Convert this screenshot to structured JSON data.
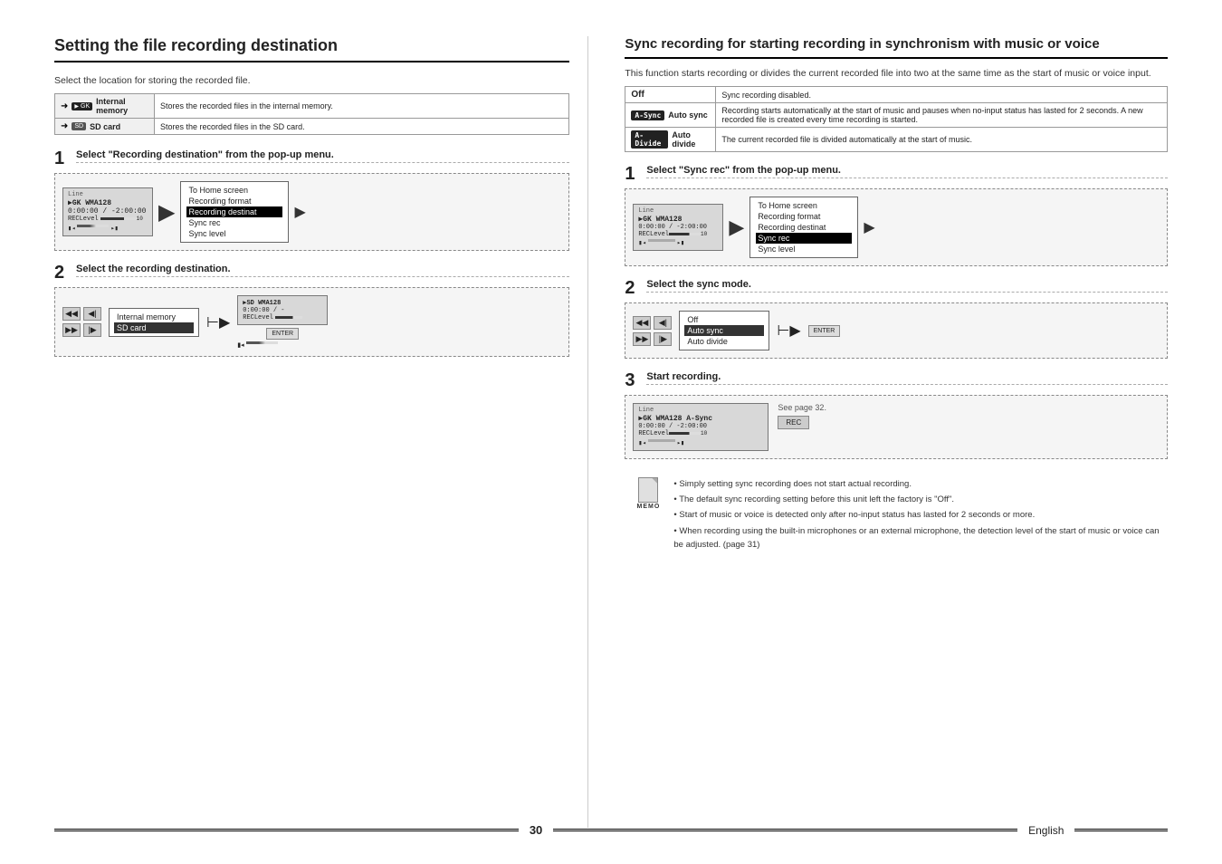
{
  "page": {
    "number": "30",
    "language": "English"
  },
  "left_section": {
    "title": "Setting the file recording destination",
    "intro": "Select the location for storing the recorded file.",
    "destination_table": {
      "rows": [
        {
          "icon_label": "INT",
          "badge": "internal",
          "name": "Internal memory",
          "description": "Stores the recorded files in the internal memory."
        },
        {
          "icon_label": "SD",
          "badge": "sd",
          "name": "SD card",
          "description": "Stores the recorded files in the SD card."
        }
      ]
    },
    "steps": [
      {
        "num": "1",
        "title": "Select \"Recording destination\" from the pop-up menu.",
        "screen": {
          "line": "Line",
          "mode": "▶GK WMA128",
          "time": "0:00:00 / -2:00:00",
          "level": "RECLevel",
          "bars": 10
        },
        "menu": {
          "items": [
            "To Home screen",
            "Recording format",
            "Recording destinat",
            "Sync rec",
            "Sync level"
          ],
          "highlighted": "Recording destinat"
        }
      },
      {
        "num": "2",
        "title": "Select the recording destination.",
        "options": [
          "Internal memory",
          "SD card"
        ],
        "highlighted": "SD card",
        "screen": {
          "mode": "▶SD WMA128",
          "time": "0:00:00 / -",
          "level": "RECLevel"
        }
      }
    ]
  },
  "right_section": {
    "title": "Sync recording for starting recording in synchronism with music or voice",
    "intro": "This function starts recording or divides the current recorded file into two at the same time as the start of music or voice input.",
    "sync_table": {
      "rows": [
        {
          "badge": "",
          "name": "Off",
          "description": "Sync recording disabled."
        },
        {
          "badge": "A-Sync",
          "badge_label": "Auto sync",
          "description": "Recording starts automatically at the start of music and pauses when no-input status has lasted for 2 seconds. A new recorded file is created every time recording is started."
        },
        {
          "badge": "A-Divide",
          "badge_label": "Auto divide",
          "description": "The current recorded file is divided automatically at the start of music."
        }
      ]
    },
    "steps": [
      {
        "num": "1",
        "title": "Select \"Sync rec\" from the pop-up menu.",
        "screen": {
          "line": "Line",
          "mode": "▶GK WMA128",
          "time": "0:00:00 / -2:00:00",
          "level": "RECLevel"
        },
        "menu": {
          "items": [
            "To Home screen",
            "Recording format",
            "Recording destinat",
            "Sync rec",
            "Sync level"
          ],
          "highlighted": "Sync rec"
        }
      },
      {
        "num": "2",
        "title": "Select the sync mode.",
        "options": [
          "Off",
          "Auto sync",
          "Auto divide"
        ],
        "highlighted": "Auto sync"
      },
      {
        "num": "3",
        "title": "Start recording.",
        "see_page": "See page 32.",
        "screen": {
          "line": "Line",
          "mode": "▶GK WMA128 A-Sync",
          "time": "0:00:00 / -2:00:00",
          "level": "RECLevel",
          "rec_indicator": "REC"
        }
      }
    ],
    "memo": {
      "label": "MEMO",
      "items": [
        "Simply setting sync recording does not start actual recording.",
        "The default sync recording setting before this unit left the factory is \"Off\".",
        "Start of music or voice is detected only after no-input status has lasted for 2 seconds or more.",
        "When recording using the built-in microphones or an external microphone, the detection level of the start of music or voice can be adjusted.  (page 31)"
      ]
    }
  }
}
